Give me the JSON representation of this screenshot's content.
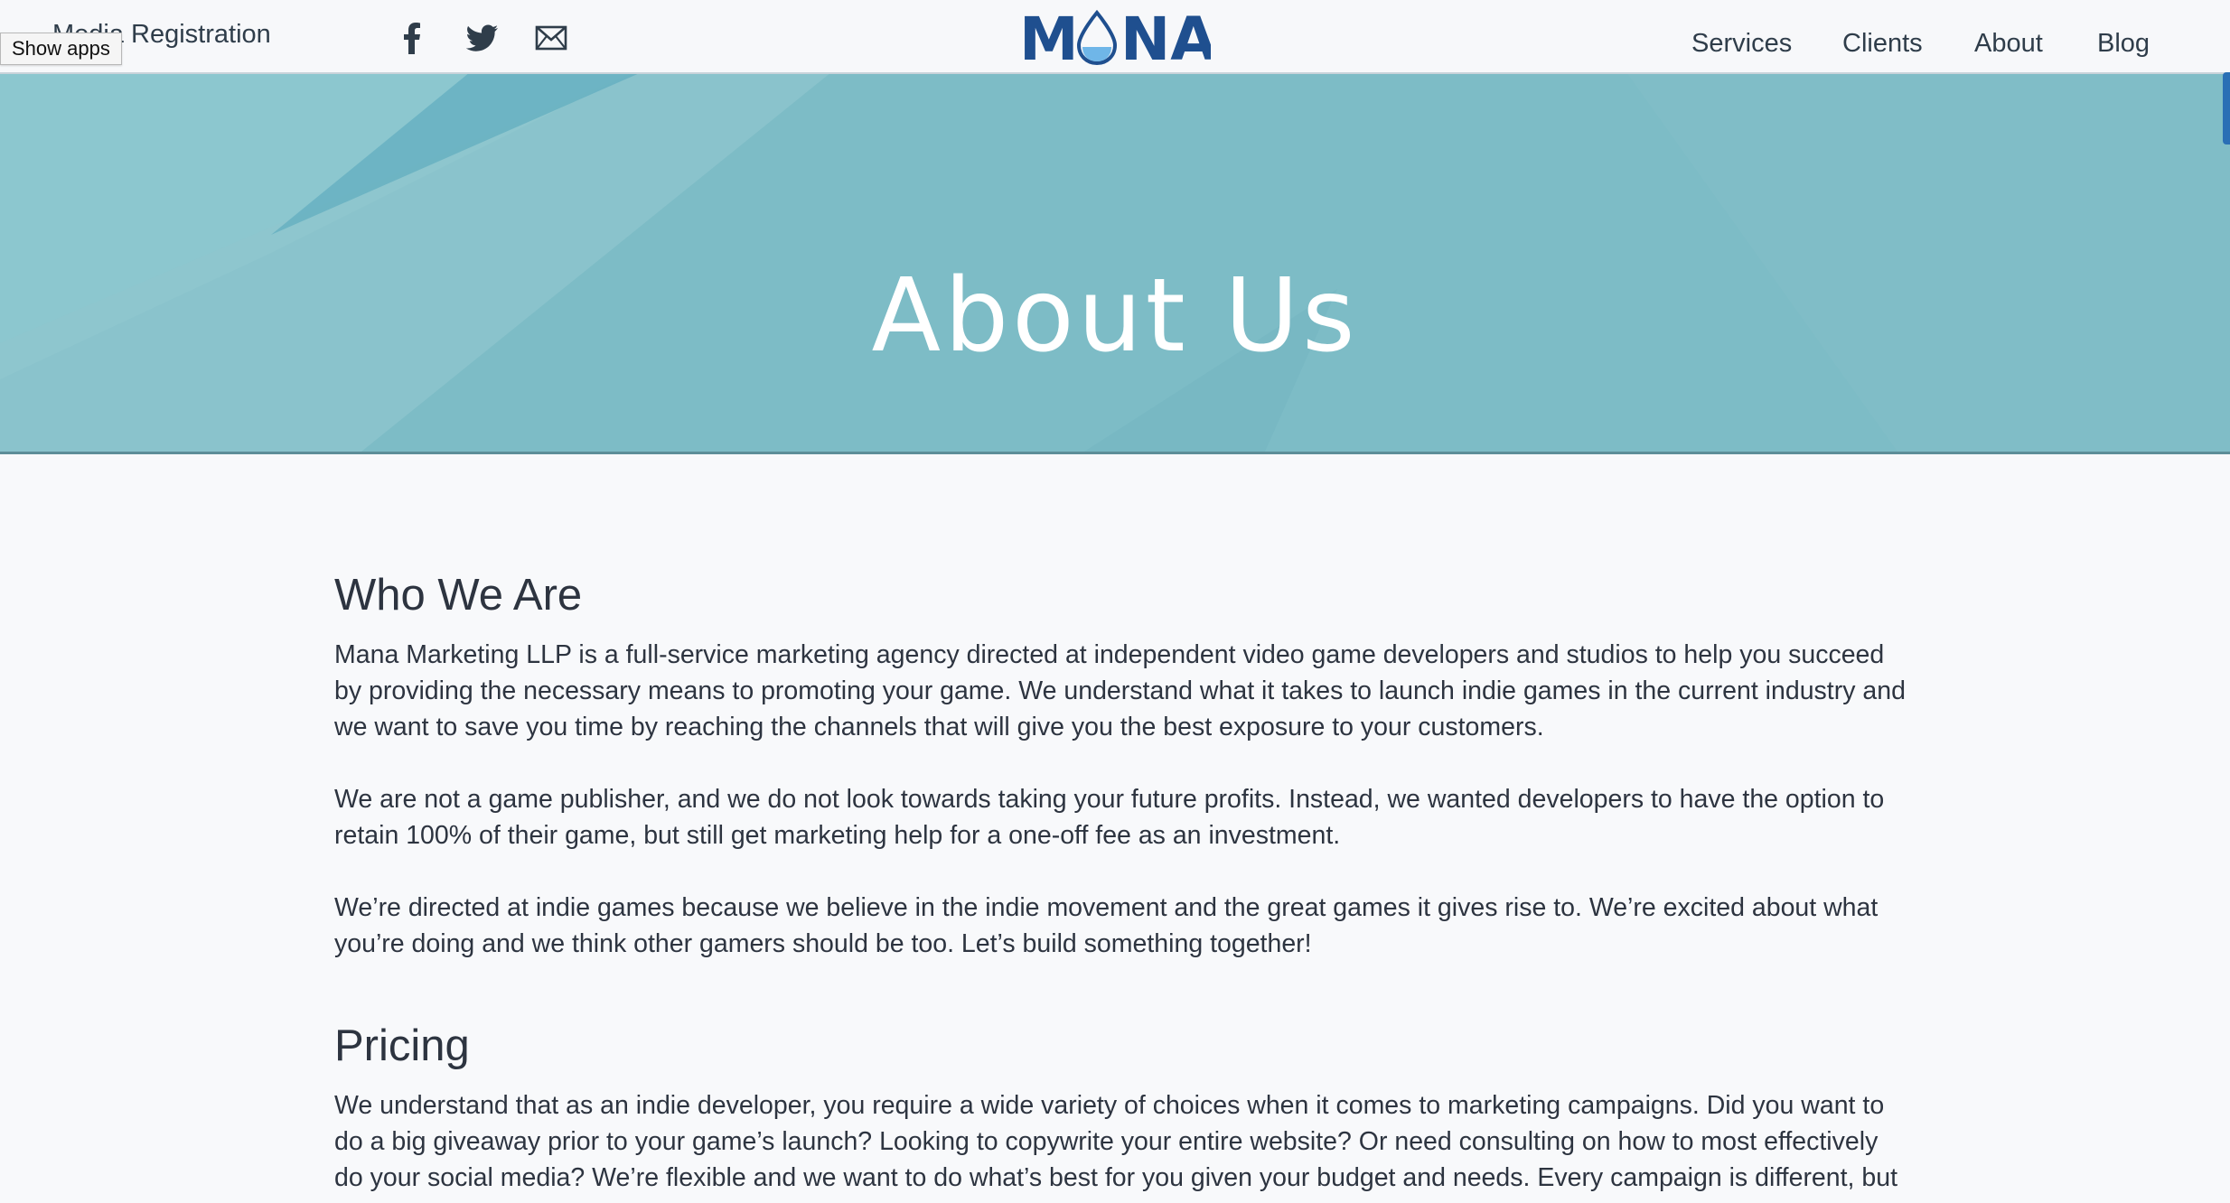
{
  "header": {
    "media_registration": "Media Registration",
    "show_apps": "Show apps",
    "social": [
      {
        "icon": "facebook-icon"
      },
      {
        "icon": "twitter-icon"
      },
      {
        "icon": "mail-icon"
      }
    ],
    "logo_text": "MANA",
    "nav": [
      {
        "label": "Services"
      },
      {
        "label": "Clients"
      },
      {
        "label": "About"
      },
      {
        "label": "Blog"
      }
    ]
  },
  "hero": {
    "title": "About Us"
  },
  "sections": [
    {
      "heading": "Who We Are",
      "paragraphs": [
        "Mana Marketing LLP is a full-service marketing agency directed at independent video game developers and studios to help you succeed by providing the necessary means to promoting your game. We understand what it takes to launch indie games in the current industry and we want to save you time by reaching the channels that will give you the best exposure to your customers.",
        "We are not a game publisher, and we do not look towards taking your future profits. Instead, we wanted developers to have the option to retain 100% of their game, but still get marketing help for a one-off fee as an investment.",
        "We’re directed at indie games because we believe in the indie movement and the great games it gives rise to. We’re excited about what you’re doing and we think other gamers should be too. Let’s build something together!"
      ]
    },
    {
      "heading": "Pricing",
      "paragraphs": [
        "We understand that as an indie developer, you require a wide variety of choices when it comes to marketing campaigns. Did you want to do a big giveaway prior to your game’s launch? Looking to copywrite your entire website? Or need consulting on how to most effectively do your social media? We’re flexible and we want to do what’s best for you given your budget and needs. Every campaign is different, but"
      ]
    }
  ],
  "colors": {
    "hero_bg": "#7dbcc6",
    "logo_blue": "#1f4f8f",
    "drop_blue": "#6fb6e8",
    "text": "#2d3440"
  }
}
